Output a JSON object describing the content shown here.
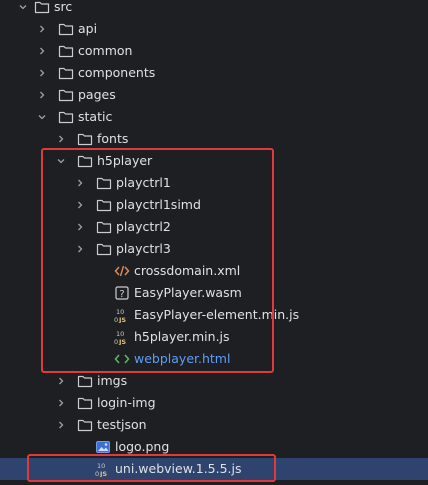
{
  "project_tree": {
    "items": [
      {
        "label": "src",
        "icon": "folder-icon",
        "expanded": true
      },
      {
        "label": "api",
        "icon": "folder-icon",
        "expanded": false
      },
      {
        "label": "common",
        "icon": "folder-icon",
        "expanded": false
      },
      {
        "label": "components",
        "icon": "folder-icon",
        "expanded": false
      },
      {
        "label": "pages",
        "icon": "folder-icon",
        "expanded": false
      },
      {
        "label": "static",
        "icon": "folder-icon",
        "expanded": true
      },
      {
        "label": "fonts",
        "icon": "folder-icon",
        "expanded": false
      },
      {
        "label": "h5player",
        "icon": "folder-icon",
        "expanded": true
      },
      {
        "label": "playctrl1",
        "icon": "folder-icon",
        "expanded": false
      },
      {
        "label": "playctrl1simd",
        "icon": "folder-icon",
        "expanded": false
      },
      {
        "label": "playctrl2",
        "icon": "folder-icon",
        "expanded": false
      },
      {
        "label": "playctrl3",
        "icon": "folder-icon",
        "expanded": false
      },
      {
        "label": "crossdomain.xml",
        "icon": "xml-file-icon"
      },
      {
        "label": "EasyPlayer.wasm",
        "icon": "unknown-file-icon"
      },
      {
        "label": "EasyPlayer-element.min.js",
        "icon": "minified-js-file-icon"
      },
      {
        "label": "h5player.min.js",
        "icon": "minified-js-file-icon"
      },
      {
        "label": "webplayer.html",
        "icon": "html-file-icon"
      },
      {
        "label": "imgs",
        "icon": "folder-icon",
        "expanded": false
      },
      {
        "label": "login-img",
        "icon": "folder-icon",
        "expanded": false
      },
      {
        "label": "testjson",
        "icon": "folder-icon",
        "expanded": false
      },
      {
        "label": "logo.png",
        "icon": "image-file-icon"
      },
      {
        "label": "uni.webview.1.5.5.js",
        "icon": "minified-js-file-icon",
        "selected": true
      }
    ]
  },
  "colors": {
    "background": "#1e1f22",
    "text": "#dfe1e5",
    "selection": "#2e436e",
    "highlight_box": "#e03a3a",
    "link_blue": "#5c9dfa"
  }
}
